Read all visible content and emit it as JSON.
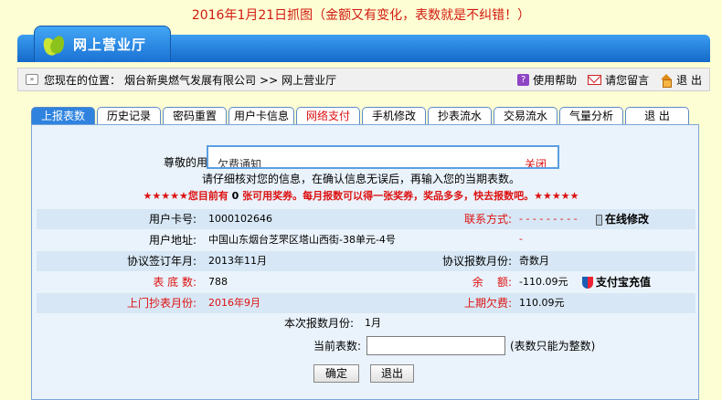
{
  "caption": "2016年1月21日抓图（金额又有变化，表数就是不纠错！）",
  "header": {
    "title": "网上营业厅"
  },
  "breadcrumb": {
    "prefix": "您现在的位置：",
    "company": "烟台新奥燃气发展有限公司",
    "sep": ">>",
    "current": "网上营业厅"
  },
  "top_links": {
    "help": "使用帮助",
    "message": "请您留言",
    "logout": "退 出"
  },
  "tabs": [
    {
      "label": "上报表数"
    },
    {
      "label": "历史记录"
    },
    {
      "label": "密码重置"
    },
    {
      "label": "用户卡信息"
    },
    {
      "label": "网络支付"
    },
    {
      "label": "手机修改"
    },
    {
      "label": "抄表流水"
    },
    {
      "label": "交易流水"
    },
    {
      "label": "气量分析"
    },
    {
      "label": "退 出"
    }
  ],
  "notice": {
    "greeting": "尊敬的用",
    "title": "欠费通知",
    "close": "关闭"
  },
  "instruction": "请仔细核对您的信息，在确认信息无误后，再输入您的当期表数。",
  "promo": {
    "stars": "★★★★★",
    "pre": "您目前有",
    "count": "0",
    "post": "张可用奖券。每月报数可以得一张奖券，奖品多多，快去报数吧。"
  },
  "info": {
    "card_label": "用户卡号:",
    "card_value": "1000102646",
    "contact_label": "联系方式:",
    "contact_value": "- - - - - - - - - -",
    "online_edit": "在线修改",
    "address_label": "用户地址:",
    "address_value": "中国山东烟台芝罘区塔山西街-38单元-4号",
    "sign_label": "协议签订年月:",
    "sign_value": "2013年11月",
    "report_month_label": "协议报数月份:",
    "report_month_value": "奇数月",
    "meter_base_label": "表 底 数:",
    "meter_base_value": "788",
    "balance_label": "余    额:",
    "balance_value": "-110.09元",
    "alipay": "支付宝充值",
    "visit_label": "上门抄表月份:",
    "visit_value": "2016年9月",
    "last_owe_label": "上期欠费:",
    "last_owe_value": "110.09元",
    "this_month_label": "本次报数月份:",
    "this_month_value": "1月",
    "current_reading_label": "当前表数:",
    "current_reading_placeholder": "",
    "hint": "(表数只能为整数)"
  },
  "buttons": {
    "confirm": "确定",
    "back": "退出"
  },
  "colors": {
    "accent": "#2f83df",
    "warning": "#d11111",
    "panel": "#eaf3fb"
  }
}
